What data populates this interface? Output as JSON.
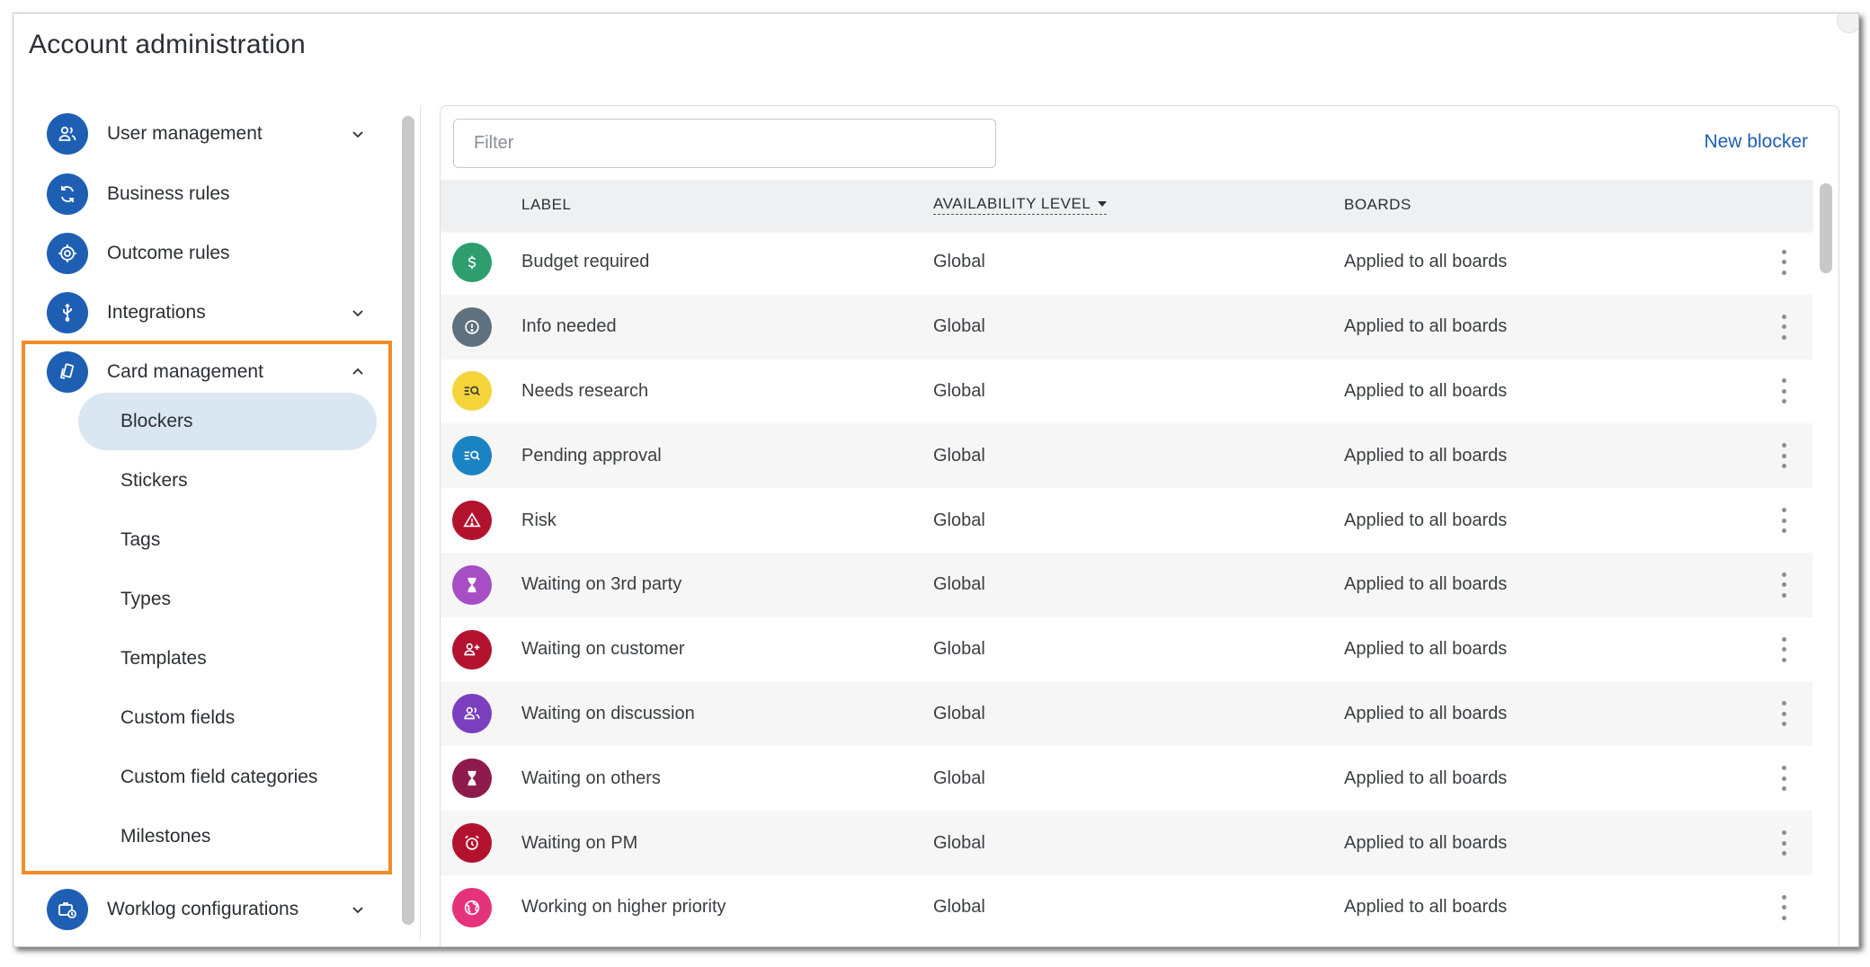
{
  "page_title": "Account administration",
  "sidebar": {
    "items": [
      {
        "label": "User management",
        "icon": "users-icon",
        "expandable": true,
        "expanded": false
      },
      {
        "label": "Business rules",
        "icon": "sync-icon",
        "expandable": false
      },
      {
        "label": "Outcome rules",
        "icon": "target-icon",
        "expandable": false
      },
      {
        "label": "Integrations",
        "icon": "usb-icon",
        "expandable": true,
        "expanded": false
      },
      {
        "label": "Card management",
        "icon": "cards-icon",
        "expandable": true,
        "expanded": true
      },
      {
        "label": "Worklog configurations",
        "icon": "briefcase-clock-icon",
        "expandable": true,
        "expanded": false
      }
    ],
    "card_management_children": [
      {
        "label": "Blockers",
        "active": true
      },
      {
        "label": "Stickers"
      },
      {
        "label": "Tags"
      },
      {
        "label": "Types"
      },
      {
        "label": "Templates"
      },
      {
        "label": "Custom fields"
      },
      {
        "label": "Custom field categories"
      },
      {
        "label": "Milestones"
      }
    ]
  },
  "main": {
    "filter_placeholder": "Filter",
    "new_blocker_label": "New blocker",
    "columns": {
      "label": "LABEL",
      "availability": "AVAILABILITY LEVEL",
      "boards": "BOARDS"
    },
    "rows": [
      {
        "label": "Budget required",
        "availability": "Global",
        "boards": "Applied to all boards",
        "icon": "dollar-icon",
        "color": "#2e9e6e"
      },
      {
        "label": "Info needed",
        "availability": "Global",
        "boards": "Applied to all boards",
        "icon": "info-alert-icon",
        "color": "#5f717f"
      },
      {
        "label": "Needs research",
        "availability": "Global",
        "boards": "Applied to all boards",
        "icon": "research-icon",
        "color": "#f5d43a"
      },
      {
        "label": "Pending approval",
        "availability": "Global",
        "boards": "Applied to all boards",
        "icon": "approval-search-icon",
        "color": "#1b82c4"
      },
      {
        "label": "Risk",
        "availability": "Global",
        "boards": "Applied to all boards",
        "icon": "warning-triangle-icon",
        "color": "#b3122e"
      },
      {
        "label": "Waiting on 3rd party",
        "availability": "Global",
        "boards": "Applied to all boards",
        "icon": "hourglass-icon",
        "color": "#a64ec4"
      },
      {
        "label": "Waiting on customer",
        "availability": "Global",
        "boards": "Applied to all boards",
        "icon": "customer-icon",
        "color": "#b3122e"
      },
      {
        "label": "Waiting on discussion",
        "availability": "Global",
        "boards": "Applied to all boards",
        "icon": "discussion-icon",
        "color": "#7b3fbf"
      },
      {
        "label": "Waiting on others",
        "availability": "Global",
        "boards": "Applied to all boards",
        "icon": "hourglass-icon",
        "color": "#8e1b4c"
      },
      {
        "label": "Waiting on PM",
        "availability": "Global",
        "boards": "Applied to all boards",
        "icon": "alarm-clock-icon",
        "color": "#b3122e"
      },
      {
        "label": "Working on higher priority",
        "availability": "Global",
        "boards": "Applied to all boards",
        "icon": "globe-icon",
        "color": "#e6317b"
      }
    ]
  },
  "colors": {
    "accent": "#1e5fb4",
    "highlight_box": "#f28c28",
    "active_bg": "#dbe6f3"
  }
}
